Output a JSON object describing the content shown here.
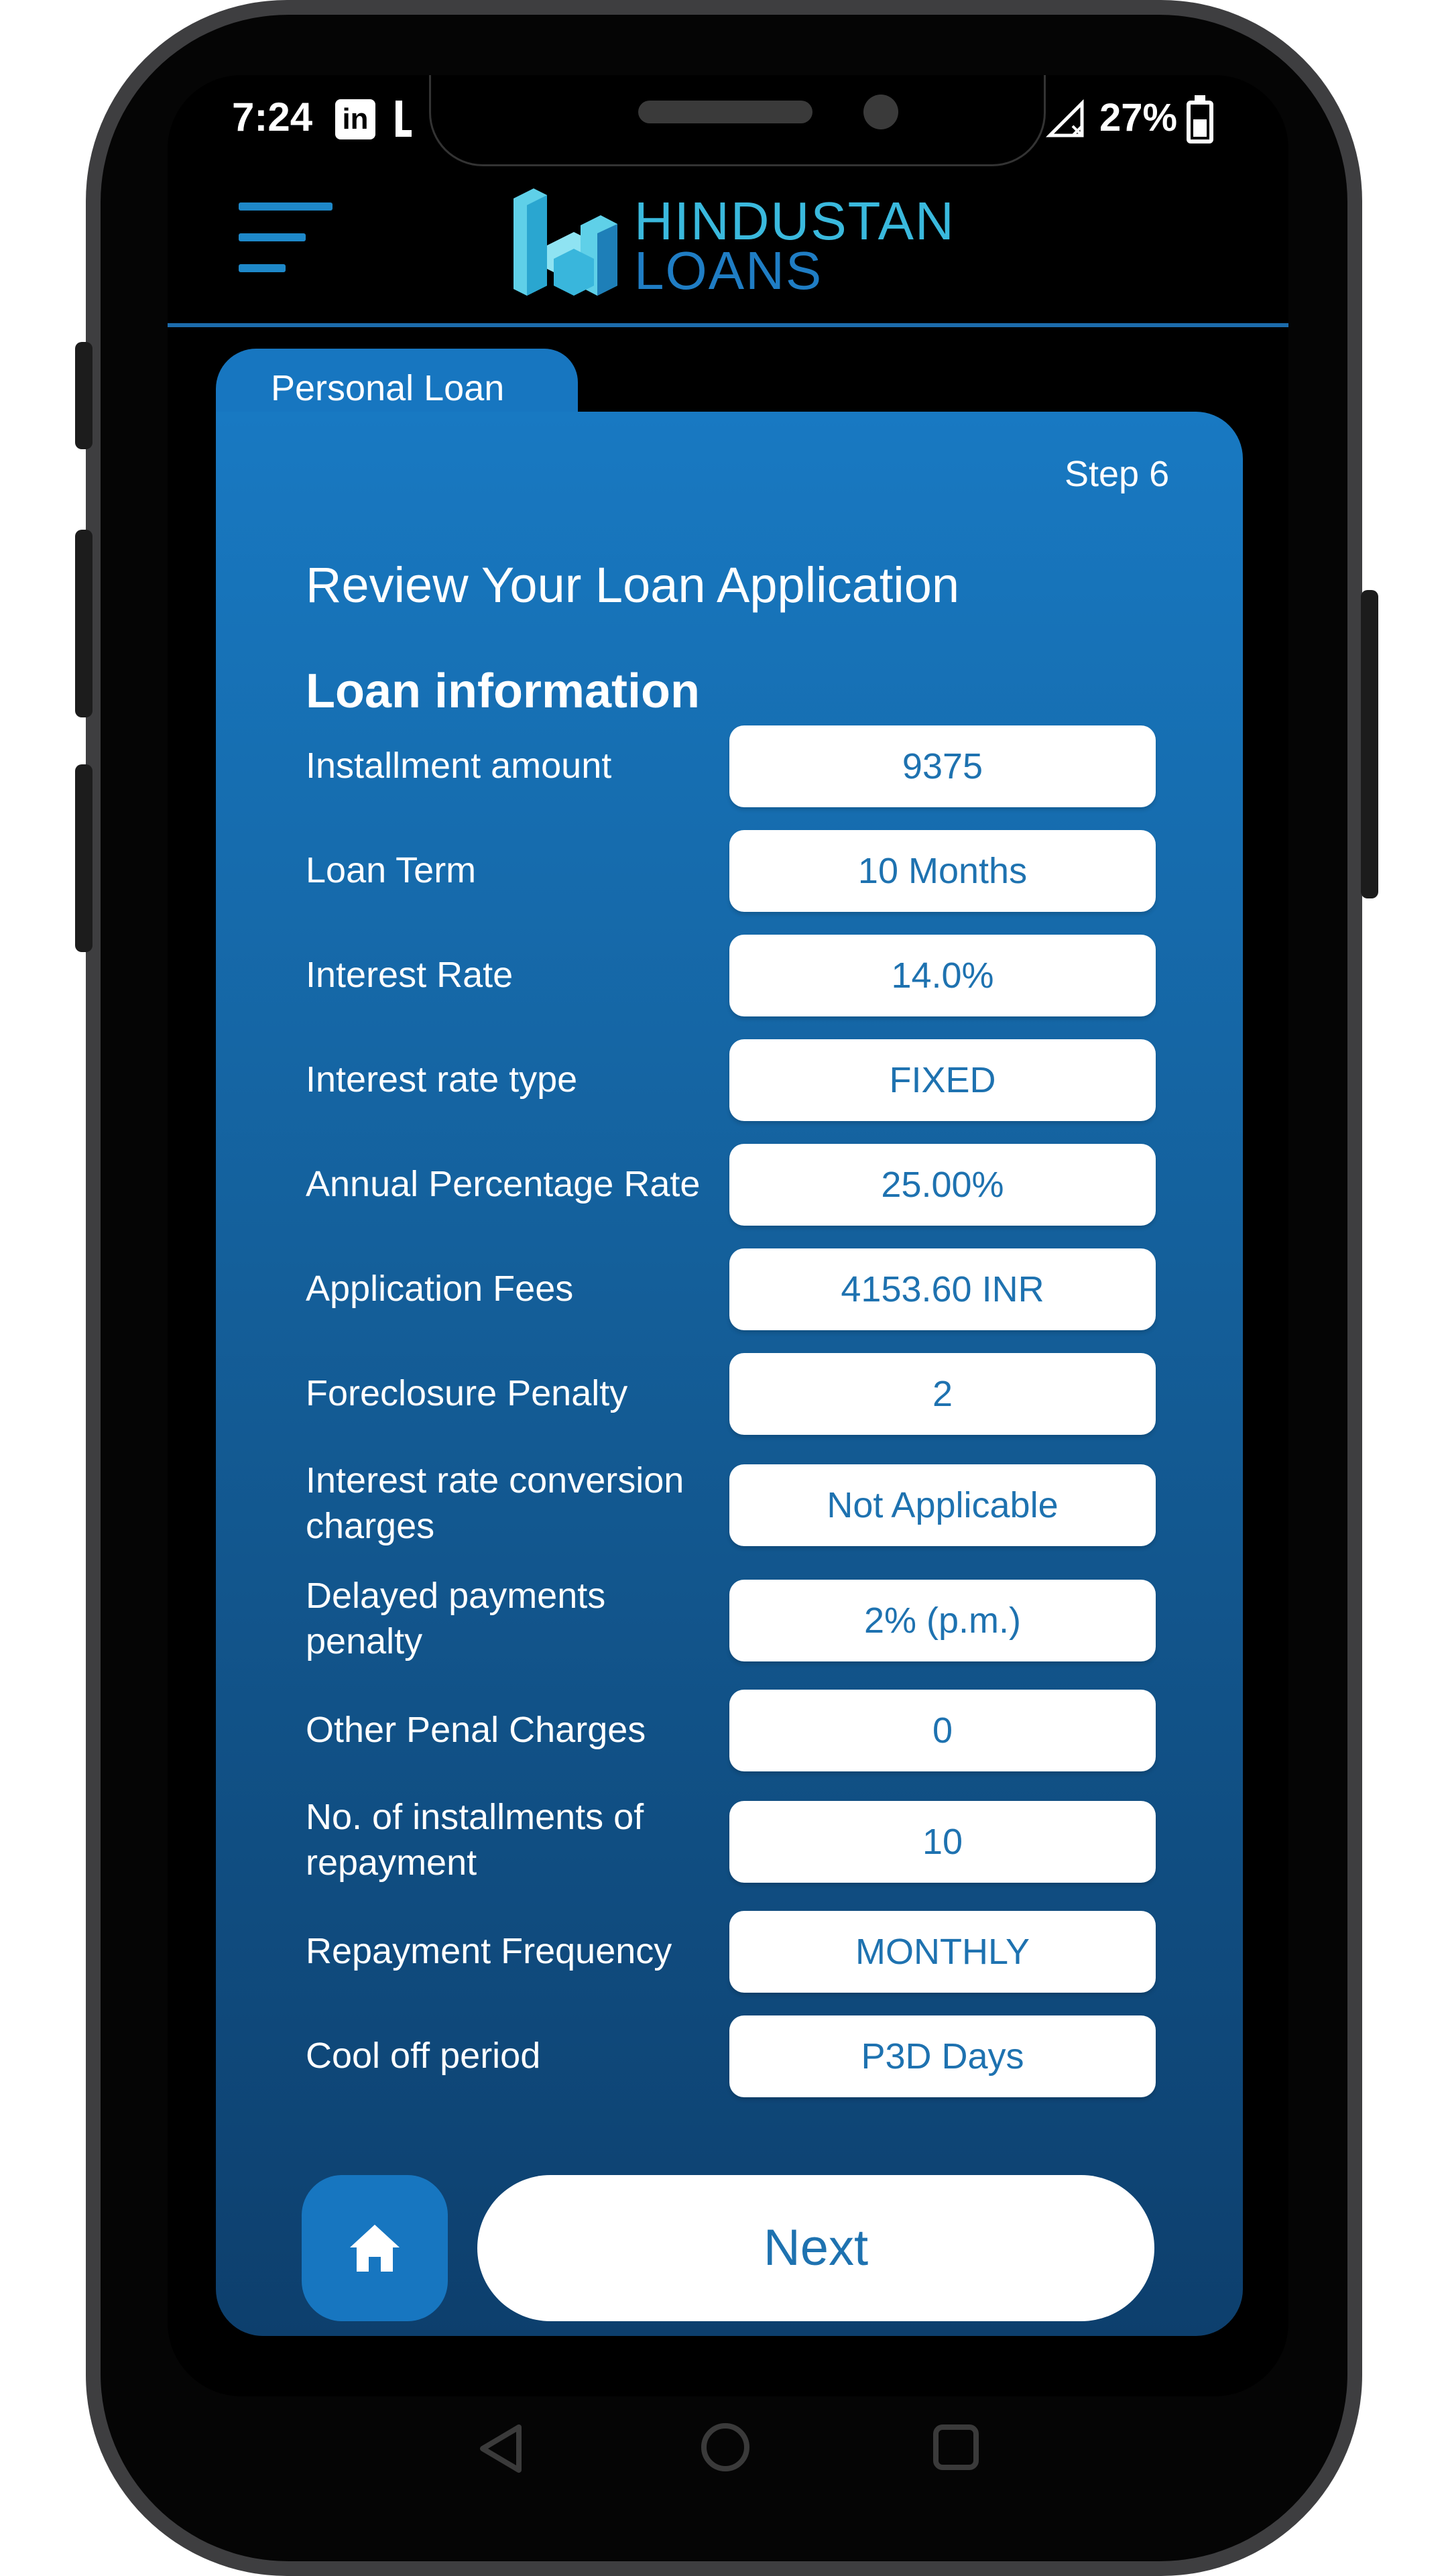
{
  "status_bar": {
    "time": "7:24",
    "battery": "27%",
    "icons": [
      "linkedin-icon",
      "notification-icon",
      "no-signal-icon",
      "battery-icon"
    ]
  },
  "header": {
    "logo_line1": "HINDUSTAN",
    "logo_line2": "LOANS",
    "icons": [
      "menu-icon",
      "logo-mark"
    ]
  },
  "card": {
    "tab_label": "Personal Loan",
    "step": "Step 6",
    "title": "Review Your Loan Application",
    "section": "Loan information"
  },
  "fields": [
    {
      "label": "Installment amount",
      "value": "9375"
    },
    {
      "label": "Loan Term",
      "value": "10 Months"
    },
    {
      "label": "Interest Rate",
      "value": "14.0%"
    },
    {
      "label": "Interest rate type",
      "value": "FIXED"
    },
    {
      "label": "Annual Percentage Rate",
      "value": "25.00%"
    },
    {
      "label": "Application Fees",
      "value": "4153.60 INR"
    },
    {
      "label": "Foreclosure Penalty",
      "value": "2"
    },
    {
      "label": "Interest rate conversion charges",
      "value": "Not Applicable"
    },
    {
      "label": "Delayed payments penalty",
      "value": "2% (p.m.)"
    },
    {
      "label": "Other Penal Charges",
      "value": "0"
    },
    {
      "label": "No. of installments of repayment",
      "value": "10"
    },
    {
      "label": "Repayment Frequency",
      "value": "MONTHLY"
    },
    {
      "label": "Cool off period",
      "value": "P3D Days"
    }
  ],
  "actions": {
    "next_label": "Next",
    "home_icon": "home-icon"
  },
  "nav_bar": {
    "icons": [
      "back-icon",
      "home-circle-icon",
      "recents-icon"
    ]
  },
  "colors": {
    "accent": "#1776c0",
    "value_text": "#1e72b0",
    "logo_light": "#3ab9dd"
  }
}
